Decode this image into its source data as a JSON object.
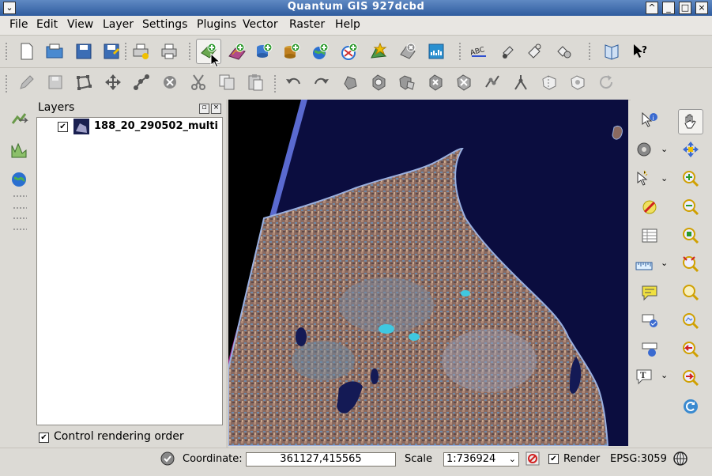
{
  "window": {
    "title": "Quantum GIS 927dcbd"
  },
  "menu": [
    "File",
    "Edit",
    "View",
    "Layer",
    "Settings",
    "Plugins",
    "Vector",
    "Raster",
    "Help"
  ],
  "layers_panel": {
    "title": "Layers",
    "layers": [
      {
        "name": "188_20_290502_multi",
        "checked": true
      }
    ],
    "control_rendering_order": {
      "label": "Control rendering order",
      "checked": true
    }
  },
  "status": {
    "coordinate_label": "Coordinate:",
    "coordinate_value": "361127,415565",
    "scale_label": "Scale",
    "scale_value": "1:736924",
    "render_label": "Render",
    "render_checked": true,
    "crs": "EPSG:3059"
  },
  "colors": {
    "titlebar": "#3d6aad",
    "map_water": "#0b0d3f",
    "land": "#a08070"
  }
}
